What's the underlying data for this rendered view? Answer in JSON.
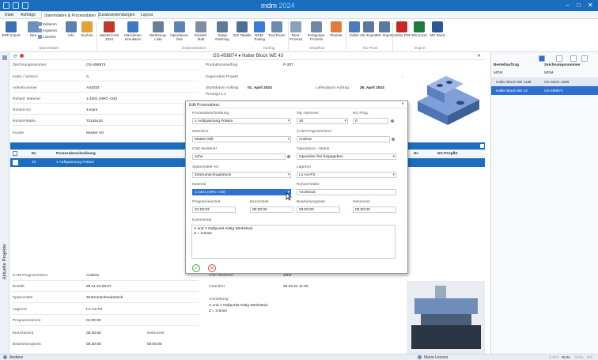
{
  "titlebar": {
    "app": "mdm",
    "year": "2024",
    "min": "–",
    "max": "□",
    "close": "✕"
  },
  "menu": [
    "Datei",
    "Aufträge",
    "Stammdaten & Prozessdaten",
    "Zusatzanwendungen",
    "Layout"
  ],
  "ribbon": {
    "small": [
      "Editieren",
      "Kopieren",
      "Löschen"
    ],
    "buttons": [
      {
        "label": "ERP Import",
        "color": "#3b6fb6"
      },
      {
        "label": "Neu",
        "color": "#6b8fbf"
      },
      {
        "label": "Info",
        "color": "#5a7fb0"
      },
      {
        "label": "Suchen",
        "color": "#e0a33a"
      },
      {
        "label": "MasterCAM 2024",
        "color": "#c0392b"
      },
      {
        "label": "Maschinen Simulation",
        "color": "#3f78c4"
      },
      {
        "label": "Werkzeug-Liste",
        "color": "#6a7f96"
      },
      {
        "label": "Operations-liste",
        "color": "#5b83b3"
      },
      {
        "label": "Einstell-blatt",
        "color": "#7d8ea3"
      },
      {
        "label": "Setup Rückzug",
        "color": "#5d7a9c"
      },
      {
        "label": "ISO Tabelle",
        "color": "#4f6f96"
      },
      {
        "label": "NDM-Tooling",
        "color": "#3a7bd5"
      },
      {
        "label": "Tool Room",
        "color": "#6b8ab0"
      },
      {
        "label": "Rüst-Prozess",
        "color": "#8aa1bb"
      },
      {
        "label": "Fertigungs-Prozess",
        "color": "#6d87a6"
      },
      {
        "label": "Planner",
        "color": "#e07b39"
      },
      {
        "label": "Editor",
        "color": "#4a7bbf"
      },
      {
        "label": "NC-Export",
        "color": "#5a79a0"
      },
      {
        "label": "NC-Import",
        "color": "#5a79a0"
      },
      {
        "label": "Adobe PDF",
        "color": "#c62828"
      },
      {
        "label": "MS Excel",
        "color": "#1f7a3f"
      },
      {
        "label": "MS Word",
        "color": "#2b5797"
      }
    ],
    "groups": [
      "Stammdaten",
      "Dokumentation",
      "Karting",
      "Shopfloor",
      "NC-Push",
      "Export"
    ]
  },
  "main": {
    "title": "GS-458874 ♦ Halter Block WE 43",
    "fields": [
      {
        "label": "Zeichnungsnummer",
        "value": "GS-458874"
      },
      {
        "label": "Index / Version",
        "value": "A"
      },
      {
        "label": "Artikelnummer",
        "value": "A43333"
      },
      {
        "label": "Rohteil: Material",
        "value": "1.4301 (HRC <40)"
      },
      {
        "label": "Rohteil-Art",
        "value": "4-Kant"
      },
      {
        "label": "Rohteil-Maße",
        "value": "72x26x15"
      },
      {
        "label": "Kunde",
        "value": "Muster AG"
      }
    ],
    "mid": [
      {
        "label": "Produktionsauftrag",
        "value": "P-307"
      },
      {
        "label": "Zugeordnet Projekt",
        "value": "-"
      },
      {
        "label": "Starttdatum Auftrag",
        "value": "01. April 2024"
      },
      {
        "label": "Prototyp 1.2",
        "value": ""
      }
    ],
    "liefer": {
      "label": "Lieferdatum Auftrag",
      "value": "26. April 2024"
    },
    "list": {
      "cols": [
        "Nr.",
        "Prozessbeschreibung",
        "Nr.",
        "NC-Progfkt."
      ],
      "row": {
        "nr": "10",
        "desc": "1 Aufspannung Fräsen"
      }
    },
    "bottom_left": [
      {
        "label": "CAM-Programmierer",
        "value": "Andrew"
      },
      {
        "label": "Erstellt",
        "value": "28.11.23 08:27"
      },
      {
        "label": "Spannmittel",
        "value": "Zentrumschraubstock"
      },
      {
        "label": "Lagerort",
        "value": "L1-A4-P2"
      },
      {
        "label": "Programmierzeit",
        "value": "01:00:00"
      },
      {
        "label": "Einrichtezeit",
        "value": "00:30:00"
      },
      {
        "label": "Bearbeitungszeit",
        "value": "00:30:00"
      }
    ],
    "bottom_right": [
      {
        "label": "CNC-Bediener",
        "value": "John"
      },
      {
        "label": "Geändert",
        "value": "28.02.24 11:00"
      },
      {
        "label": "Anmerkung",
        "value": "X und Y Nullpunkt mittig Werkstück"
      },
      {
        "label": "",
        "value": "Z = 3.5mm"
      }
    ],
    "nebenzeit": {
      "label": "Nebenzeit",
      "value": "00:00:00"
    }
  },
  "right": {
    "col1": "Bestellauftrag",
    "col2": "Zeichnungsnummer",
    "rows": [
      [
        "MDM",
        "MDM"
      ],
      [
        "Halter Block WE 1138",
        "GS-353/1.1508"
      ],
      [
        "Halter Block WE 43",
        "GS-458874"
      ]
    ]
  },
  "sidebar": {
    "label": "Aktuelle Projekte"
  },
  "status": {
    "user": "Andrew",
    "operator": "Mario Lenovo",
    "caps": "CAPS",
    "num": "NUM",
    "scrl": "SCRL",
    "ins": "INS"
  },
  "dialog": {
    "title": "Edit Prozessbesc.",
    "fields": {
      "prozess": {
        "label": "Prozessbeschreibung",
        "value": "1 Aufspannung Fräsen"
      },
      "opnr": {
        "label": "Op.-Nummer",
        "value": "10"
      },
      "ncprog": {
        "label": "NC-Prog.",
        "value": "0"
      },
      "maschine": {
        "label": "Maschine",
        "value": "Master-Mill"
      },
      "cam": {
        "label": "CAM-Programmierer",
        "value": "Andrew"
      },
      "cnc": {
        "label": "CNC-Bediener",
        "value": "John"
      },
      "status": {
        "label": "Operations - Status",
        "value": "Operation frei freigegeben"
      },
      "spann": {
        "label": "Spannmittel-Art",
        "value": "Zentrumschraubstock"
      },
      "lager": {
        "label": "Lagerort",
        "value": "L1-A4-P2"
      },
      "material": {
        "label": "Material",
        "value": "1.4301 (HRC <40)"
      },
      "masse": {
        "label": "Rohteil-Maße",
        "value": "72x26x15"
      },
      "prog": {
        "label": "Programmierzeit",
        "value": "01:00:03"
      },
      "einricht": {
        "label": "Einrichtzeit",
        "value": "00:30:00"
      },
      "bearb": {
        "label": "Bearbeitungszeit",
        "value": "00:00:00"
      },
      "neben": {
        "label": "Nebenzeit",
        "value": "00:00:00"
      }
    },
    "kommentar": {
      "label": "Kommentar",
      "value": "X und Y Nullpunkt mittig Werkstück\nZ = 3.5mm"
    },
    "ok": "✓",
    "cancel": "✕"
  }
}
